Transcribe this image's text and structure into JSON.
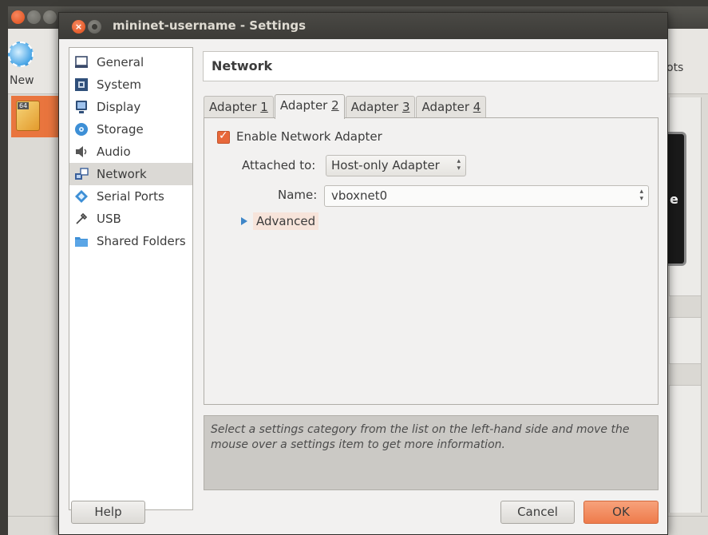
{
  "background_window": {
    "toolbar": {
      "new_label": "New",
      "partial_right_label": "ots"
    },
    "vm_badge": "64",
    "preview_letter": "e"
  },
  "dialog": {
    "title": "mininet-username - Settings",
    "sidebar": {
      "items": [
        {
          "label": "General",
          "icon": "general-icon",
          "selected": false
        },
        {
          "label": "System",
          "icon": "system-icon",
          "selected": false
        },
        {
          "label": "Display",
          "icon": "display-icon",
          "selected": false
        },
        {
          "label": "Storage",
          "icon": "storage-icon",
          "selected": false
        },
        {
          "label": "Audio",
          "icon": "audio-icon",
          "selected": false
        },
        {
          "label": "Network",
          "icon": "network-icon",
          "selected": true
        },
        {
          "label": "Serial Ports",
          "icon": "serial-ports-icon",
          "selected": false
        },
        {
          "label": "USB",
          "icon": "usb-icon",
          "selected": false
        },
        {
          "label": "Shared Folders",
          "icon": "folder-icon",
          "selected": false
        }
      ]
    },
    "header": {
      "title": "Network"
    },
    "tabs": [
      {
        "label": "Adapter ",
        "key": "1",
        "active": false
      },
      {
        "label": "Adapter ",
        "key": "2",
        "active": true
      },
      {
        "label": "Adapter ",
        "key": "3",
        "active": false
      },
      {
        "label": "Adapter ",
        "key": "4",
        "active": false
      }
    ],
    "adapter": {
      "enable_label": "Enable Network Adapter",
      "enabled": true,
      "attached_to_label": "Attached to:",
      "attached_to_value": "Host-only Adapter",
      "name_label": "Name:",
      "name_value": "vboxnet0",
      "advanced_label": "Advanced"
    },
    "info_text": "Select a settings category from the list on the left-hand side and move the mouse over a settings item to get more information.",
    "buttons": {
      "help": "Help",
      "cancel": "Cancel",
      "ok": "OK"
    }
  },
  "colors": {
    "accent": "#ee7b4b",
    "selection": "#dbd9d5",
    "titlebar": "#3c3b37"
  }
}
